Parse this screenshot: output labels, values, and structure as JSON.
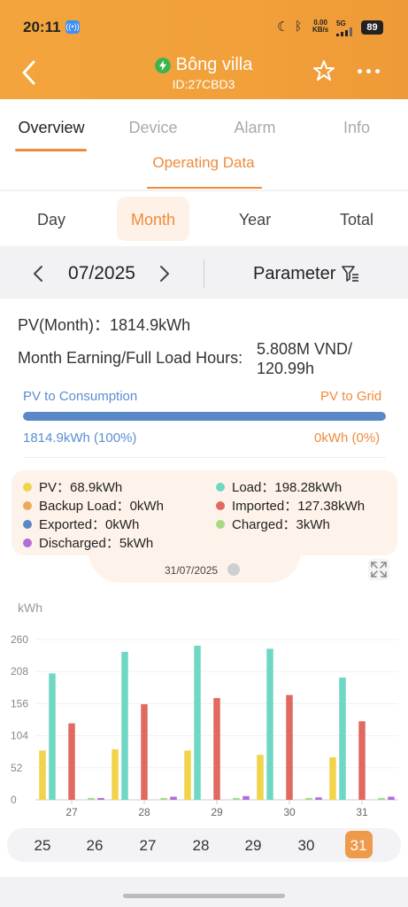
{
  "status_bar": {
    "time": "20:11",
    "speed_value": "0.00",
    "speed_unit": "KB/s",
    "network": "5G",
    "battery": "89"
  },
  "header": {
    "title": "Bông villa",
    "subtitle": "ID:27CBD3"
  },
  "tabs": [
    {
      "label": "Overview",
      "active": true
    },
    {
      "label": "Device",
      "active": false
    },
    {
      "label": "Alarm",
      "active": false
    },
    {
      "label": "Info",
      "active": false
    }
  ],
  "section_title": "Operating Data",
  "periods": [
    {
      "label": "Day",
      "active": false
    },
    {
      "label": "Month",
      "active": true
    },
    {
      "label": "Year",
      "active": false
    },
    {
      "label": "Total",
      "active": false
    }
  ],
  "date_nav": {
    "date": "07/2025",
    "parameter_label": "Parameter"
  },
  "summary": {
    "pv_month": "PV(Month)：1814.9kWh",
    "earning_label": "Month Earning/Full Load Hours:",
    "earning_value": "5.808M VND/\n120.99h"
  },
  "flow": {
    "left_label": "PV to Consumption",
    "right_label": "PV to Grid",
    "left_value": "1814.9kWh (100%)",
    "right_value": "0kWh (0%)",
    "fraction": 1.0
  },
  "tooltip": {
    "items": [
      {
        "label": "PV：68.9kWh",
        "color": "#f1d44a"
      },
      {
        "label": "Load：198.28kWh",
        "color": "#6fd8c4"
      },
      {
        "label": "Backup Load：0kWh",
        "color": "#eda95b"
      },
      {
        "label": "Imported：127.38kWh",
        "color": "#e06a60"
      },
      {
        "label": "Exported：0kWh",
        "color": "#5a87c7"
      },
      {
        "label": "Charged：3kWh",
        "color": "#a6d985"
      },
      {
        "label": "Discharged：5kWh",
        "color": "#b36bd8"
      }
    ],
    "date": "31/07/2025"
  },
  "chart_data": {
    "type": "bar",
    "ylabel": "kWh",
    "yticks": [
      "0",
      "52",
      "104",
      "156",
      "208",
      "260"
    ],
    "ylim": [
      0,
      260
    ],
    "categories": [
      "27",
      "28",
      "29",
      "30",
      "31"
    ],
    "series": [
      {
        "name": "PV",
        "color": "#f1d44a",
        "values": [
          80,
          82,
          80,
          73,
          69
        ]
      },
      {
        "name": "Load",
        "color": "#6fd8c4",
        "values": [
          205,
          240,
          250,
          245,
          198.28
        ]
      },
      {
        "name": "Backup Load",
        "color": "#eda95b",
        "values": [
          0,
          0,
          0,
          0,
          0
        ]
      },
      {
        "name": "Imported",
        "color": "#e06a60",
        "values": [
          124,
          155,
          165,
          170,
          127.38
        ]
      },
      {
        "name": "Exported",
        "color": "#5a87c7",
        "values": [
          0,
          0,
          0,
          0,
          0
        ]
      },
      {
        "name": "Charged",
        "color": "#a6d985",
        "values": [
          3,
          3,
          3,
          3,
          3
        ]
      },
      {
        "name": "Discharged",
        "color": "#b36bd8",
        "values": [
          3,
          5,
          6,
          4,
          5
        ]
      }
    ],
    "grid": true
  },
  "day_selector": {
    "days": [
      "25",
      "26",
      "27",
      "28",
      "29",
      "30",
      "31"
    ],
    "selected": "31"
  }
}
